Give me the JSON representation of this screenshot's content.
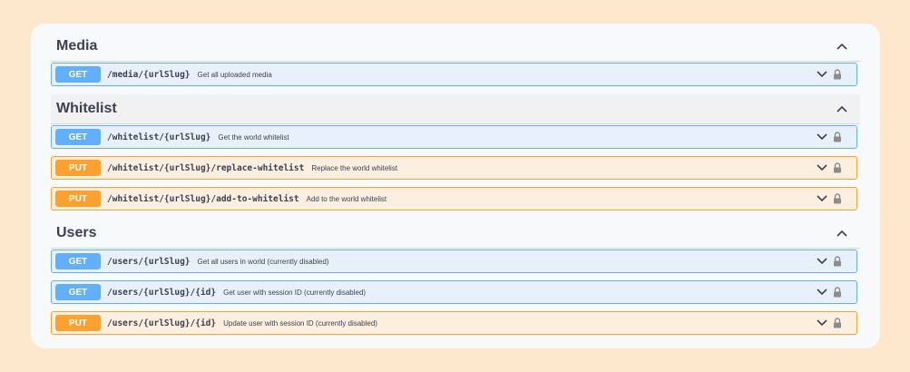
{
  "sections": [
    {
      "title": "Media",
      "operations": [
        {
          "method": "GET",
          "path": "/media/{urlSlug}",
          "summary": "Get all uploaded media"
        }
      ]
    },
    {
      "title": "Whitelist",
      "operations": [
        {
          "method": "GET",
          "path": "/whitelist/{urlSlug}",
          "summary": "Get the world whitelist"
        },
        {
          "method": "PUT",
          "path": "/whitelist/{urlSlug}/replace-whitelist",
          "summary": "Replace the world whitelist"
        },
        {
          "method": "PUT",
          "path": "/whitelist/{urlSlug}/add-to-whitelist",
          "summary": "Add to the world whitelist"
        }
      ]
    },
    {
      "title": "Users",
      "operations": [
        {
          "method": "GET",
          "path": "/users/{urlSlug}",
          "summary": "Get all users in world (currently disabled)"
        },
        {
          "method": "GET",
          "path": "/users/{urlSlug}/{id}",
          "summary": "Get user with session ID (currently disabled)"
        },
        {
          "method": "PUT",
          "path": "/users/{urlSlug}/{id}",
          "summary": "Update user with session ID (currently disabled)"
        }
      ]
    }
  ],
  "colors": {
    "get": "#61affe",
    "put": "#fca130",
    "page_background": "#fde8cd",
    "card_background": "#f8f9fa"
  },
  "icons": {
    "section_toggle": "chevron-up-icon",
    "operation_expand": "chevron-down-icon",
    "operation_auth": "lock-icon"
  }
}
